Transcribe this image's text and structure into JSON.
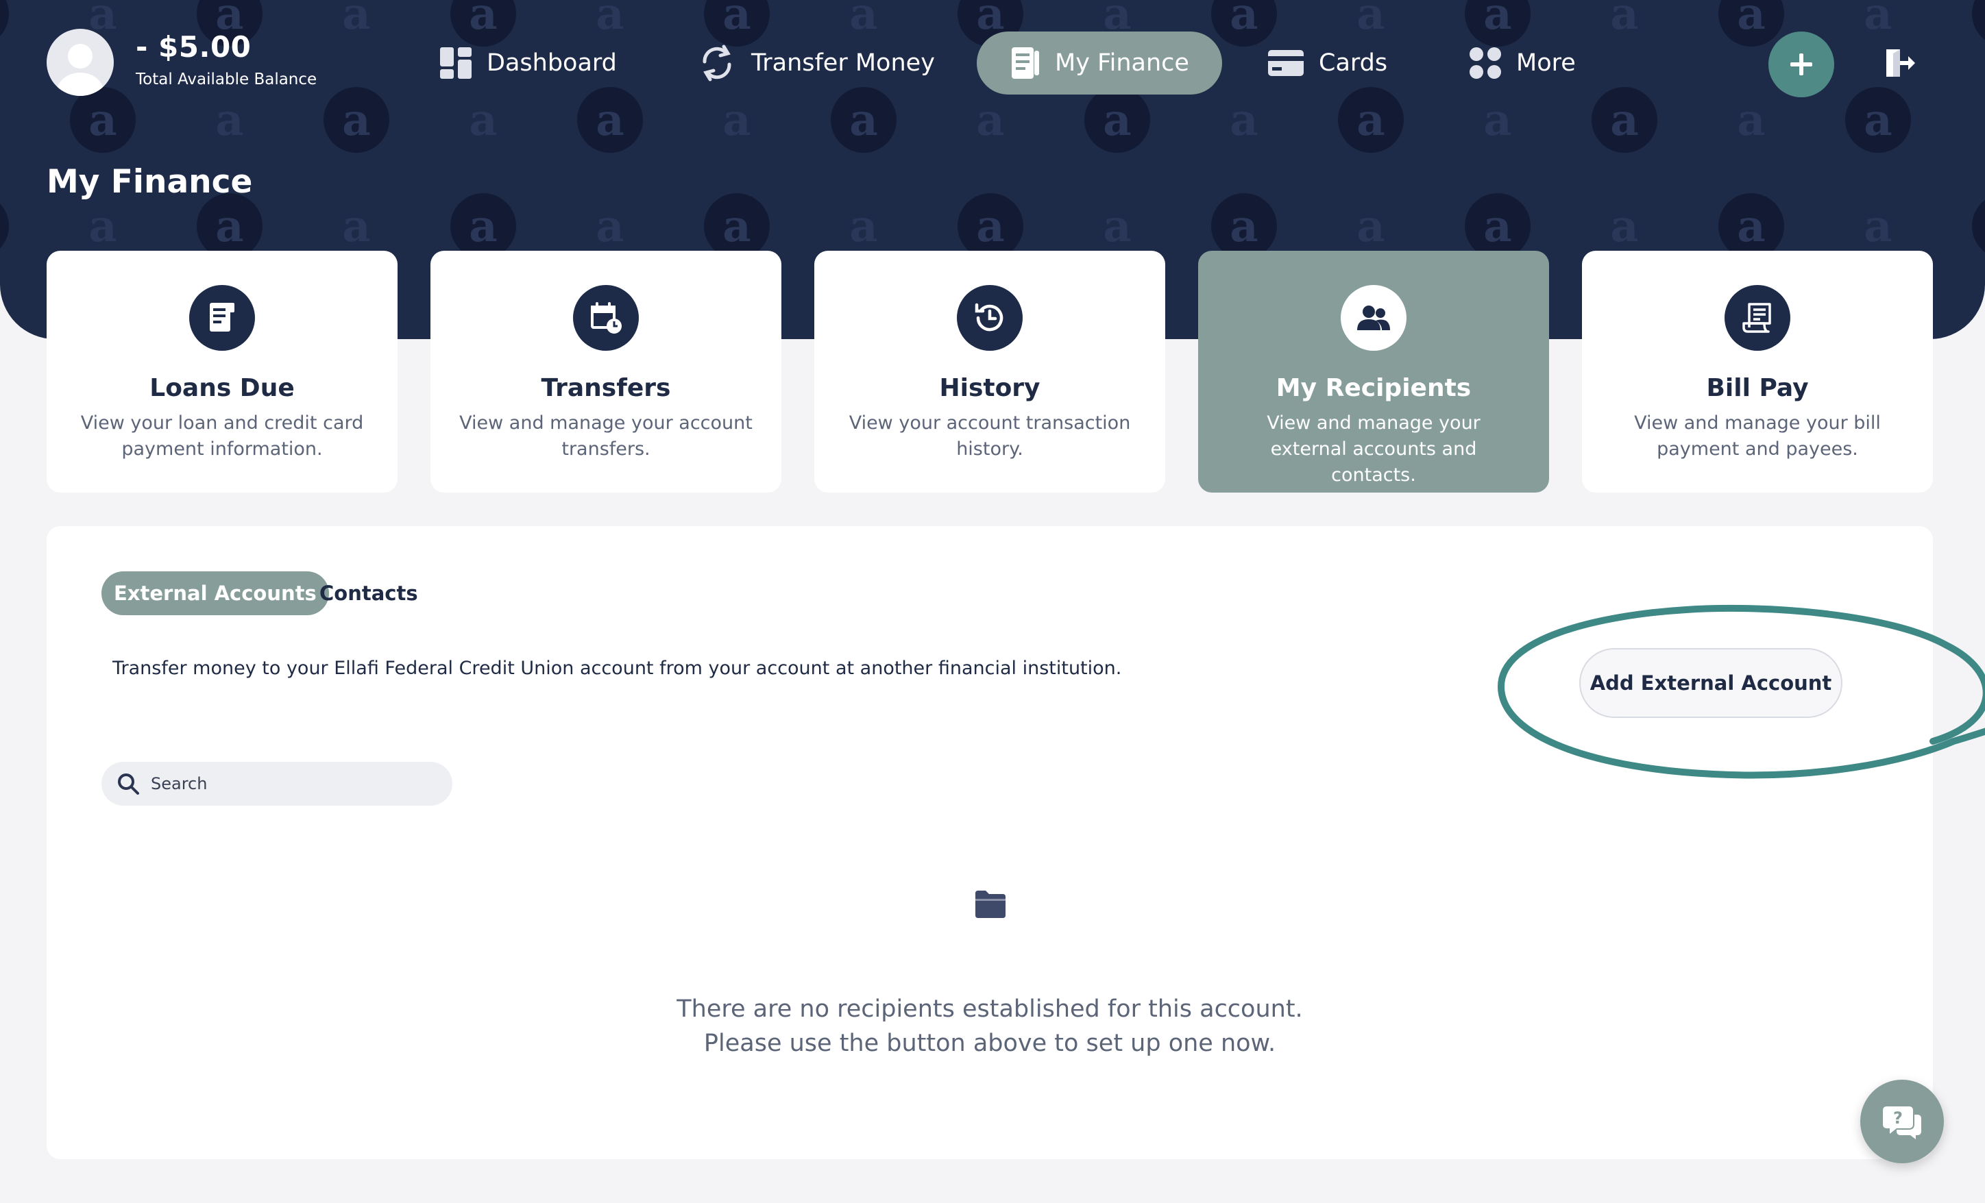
{
  "header": {
    "balance_amount": "- $5.00",
    "balance_label": "Total Available Balance"
  },
  "nav": {
    "dashboard": "Dashboard",
    "transfer_money": "Transfer Money",
    "my_finance": "My Finance",
    "cards": "Cards",
    "more": "More"
  },
  "page_title": "My Finance",
  "cards": [
    {
      "title": "Loans Due",
      "desc": "View your loan and credit card payment information."
    },
    {
      "title": "Transfers",
      "desc": "View and manage your account transfers."
    },
    {
      "title": "History",
      "desc": "View your account transaction history."
    },
    {
      "title": "My Recipients",
      "desc": "View and manage your external accounts and contacts."
    },
    {
      "title": "Bill Pay",
      "desc": "View and manage your bill payment and payees."
    }
  ],
  "panel": {
    "tab_external": "External Accounts",
    "tab_contacts": "Contacts",
    "info": "Transfer money to your Ellafi Federal Credit Union account from your account at another financial institution.",
    "add_button": "Add External Account",
    "search_placeholder": "Search",
    "empty_line1": "There are no recipients established for this account.",
    "empty_line2": "Please use the button above to set up one now."
  },
  "colors": {
    "header_bg": "#1d2a48",
    "accent": "#869d99",
    "add_button": "#4f8a87",
    "annotation": "#3e8885"
  },
  "icons": [
    "dashboard-icon",
    "transfer-icon",
    "finance-icon",
    "cards-icon",
    "more-icon",
    "plus-icon",
    "logout-icon",
    "search-icon",
    "folder-icon",
    "chat-help-icon"
  ]
}
